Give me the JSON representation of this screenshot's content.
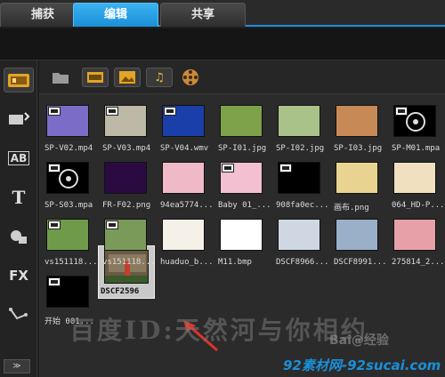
{
  "tabs": [
    {
      "label": "捕获"
    },
    {
      "label": "编辑"
    },
    {
      "label": "共享"
    }
  ],
  "active_tab": "编辑",
  "sidebar": {
    "items": [
      {
        "name": "media-library-icon"
      },
      {
        "name": "transition-icon"
      },
      {
        "name": "ab-icon",
        "text": "AB"
      },
      {
        "name": "title-icon",
        "text": "T"
      },
      {
        "name": "graphics-icon"
      },
      {
        "name": "fx-icon",
        "text": "FX"
      },
      {
        "name": "path-icon"
      }
    ]
  },
  "toolbar": {
    "buttons": [
      "folder-icon",
      "video-filter-icon",
      "image-filter-icon",
      "audio-filter-icon",
      "film-reel-icon"
    ]
  },
  "media": [
    {
      "label": "SP-V02.mp4",
      "type": "video",
      "color": "#7b6cc8"
    },
    {
      "label": "SP-V03.mp4",
      "type": "video",
      "color": "#bdb9a6"
    },
    {
      "label": "SP-V04.wmv",
      "type": "video",
      "color": "#1a3fa8"
    },
    {
      "label": "SP-I01.jpg",
      "type": "image",
      "color": "#7da24a"
    },
    {
      "label": "SP-I02.jpg",
      "type": "image",
      "color": "#a9c28a"
    },
    {
      "label": "SP-I03.jpg",
      "type": "image",
      "color": "#c78a57"
    },
    {
      "label": "SP-M01.mpa",
      "type": "audio",
      "color": "#000000"
    },
    {
      "label": "SP-S03.mpa",
      "type": "audio",
      "color": "#000000"
    },
    {
      "label": "FR-F02.png",
      "type": "image",
      "color": "#2a0a40"
    },
    {
      "label": "94ea5774...",
      "type": "image",
      "color": "#f0b9c8"
    },
    {
      "label": "Baby 01_...",
      "type": "video",
      "color": "#f2c0d0"
    },
    {
      "label": "908fa0ec...",
      "type": "video",
      "color": "#000000"
    },
    {
      "label": "画布.png",
      "type": "image",
      "color": "#e8d490"
    },
    {
      "label": "064_HD-P...",
      "type": "image",
      "color": "#f0e0c0"
    },
    {
      "label": "vs151118...",
      "type": "video",
      "color": "#6f9a4a"
    },
    {
      "label": "vs151118...",
      "type": "video",
      "color": "#7a9a5a"
    },
    {
      "label": "huaduo_b...",
      "type": "image",
      "color": "#f5f0e8"
    },
    {
      "label": "M11.bmp",
      "type": "image",
      "color": "#ffffff"
    },
    {
      "label": "DSCF8966...",
      "type": "image",
      "color": "#cfd8e2"
    },
    {
      "label": "DSCF8991...",
      "type": "image",
      "color": "#9ab0c8"
    },
    {
      "label": "275814_2...",
      "type": "image",
      "color": "#e8a0a8"
    },
    {
      "label": "开始 001...",
      "type": "video",
      "color": "#000000"
    }
  ],
  "selected_item": {
    "label": "DSCF2596",
    "color": "#6a5a44"
  },
  "watermark": "百度ID:天然河与你相约",
  "baidu_logo": "Bai@经验",
  "site": "92素材网-92sucai.com",
  "scroll_button": "≫"
}
